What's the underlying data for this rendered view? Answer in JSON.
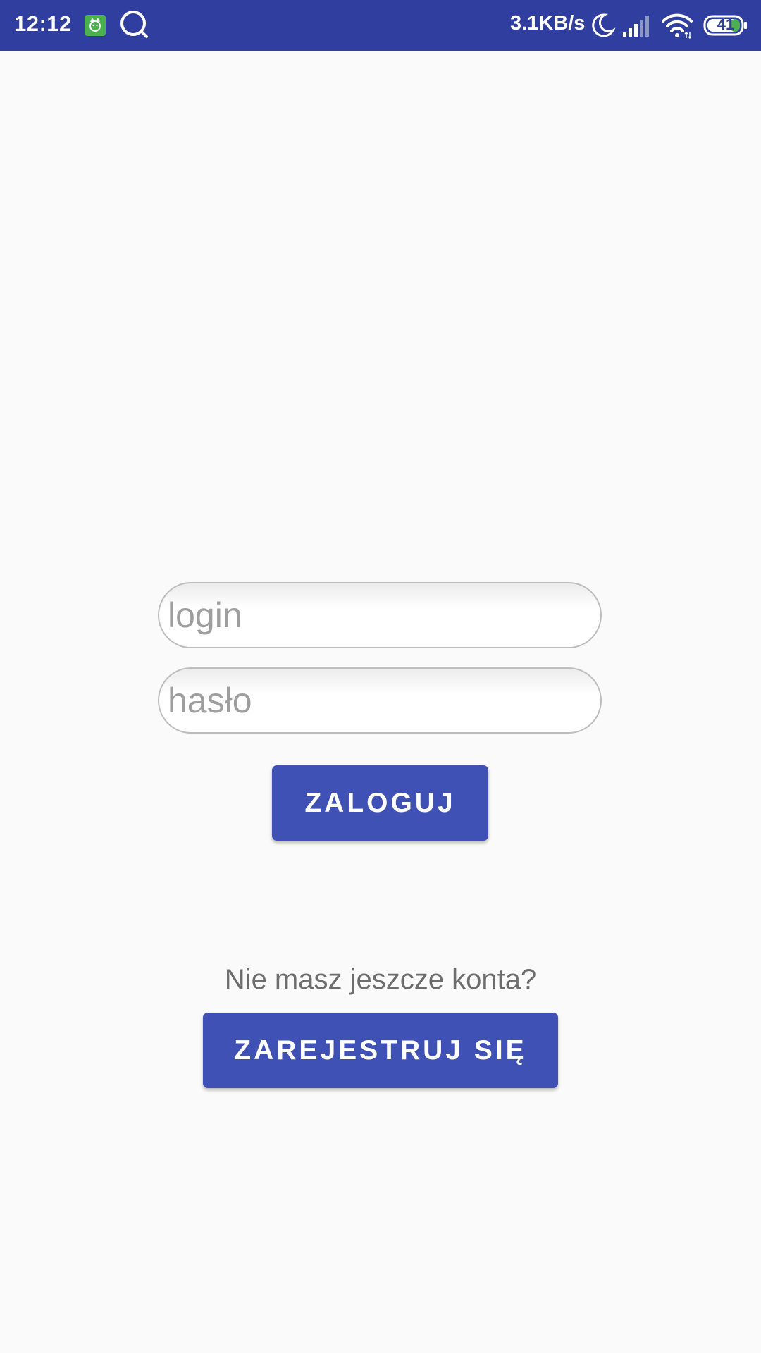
{
  "status_bar": {
    "time": "12:12",
    "network_speed": "3.1KB/s",
    "battery_level": "41",
    "icons": [
      "app-notification-icon",
      "search-icon",
      "moon-icon",
      "signal-icon",
      "wifi-icon",
      "battery-icon"
    ]
  },
  "login_form": {
    "login_placeholder": "login",
    "login_value": "",
    "password_placeholder": "hasło",
    "password_value": "",
    "login_button_label": "ZALOGUJ"
  },
  "register": {
    "prompt": "Nie masz jeszcze konta?",
    "register_button_label": "ZAREJESTRUJ SIĘ"
  },
  "colors": {
    "status_bar": "#303f9f",
    "button": "#3f51b5",
    "background": "#fafafa"
  }
}
